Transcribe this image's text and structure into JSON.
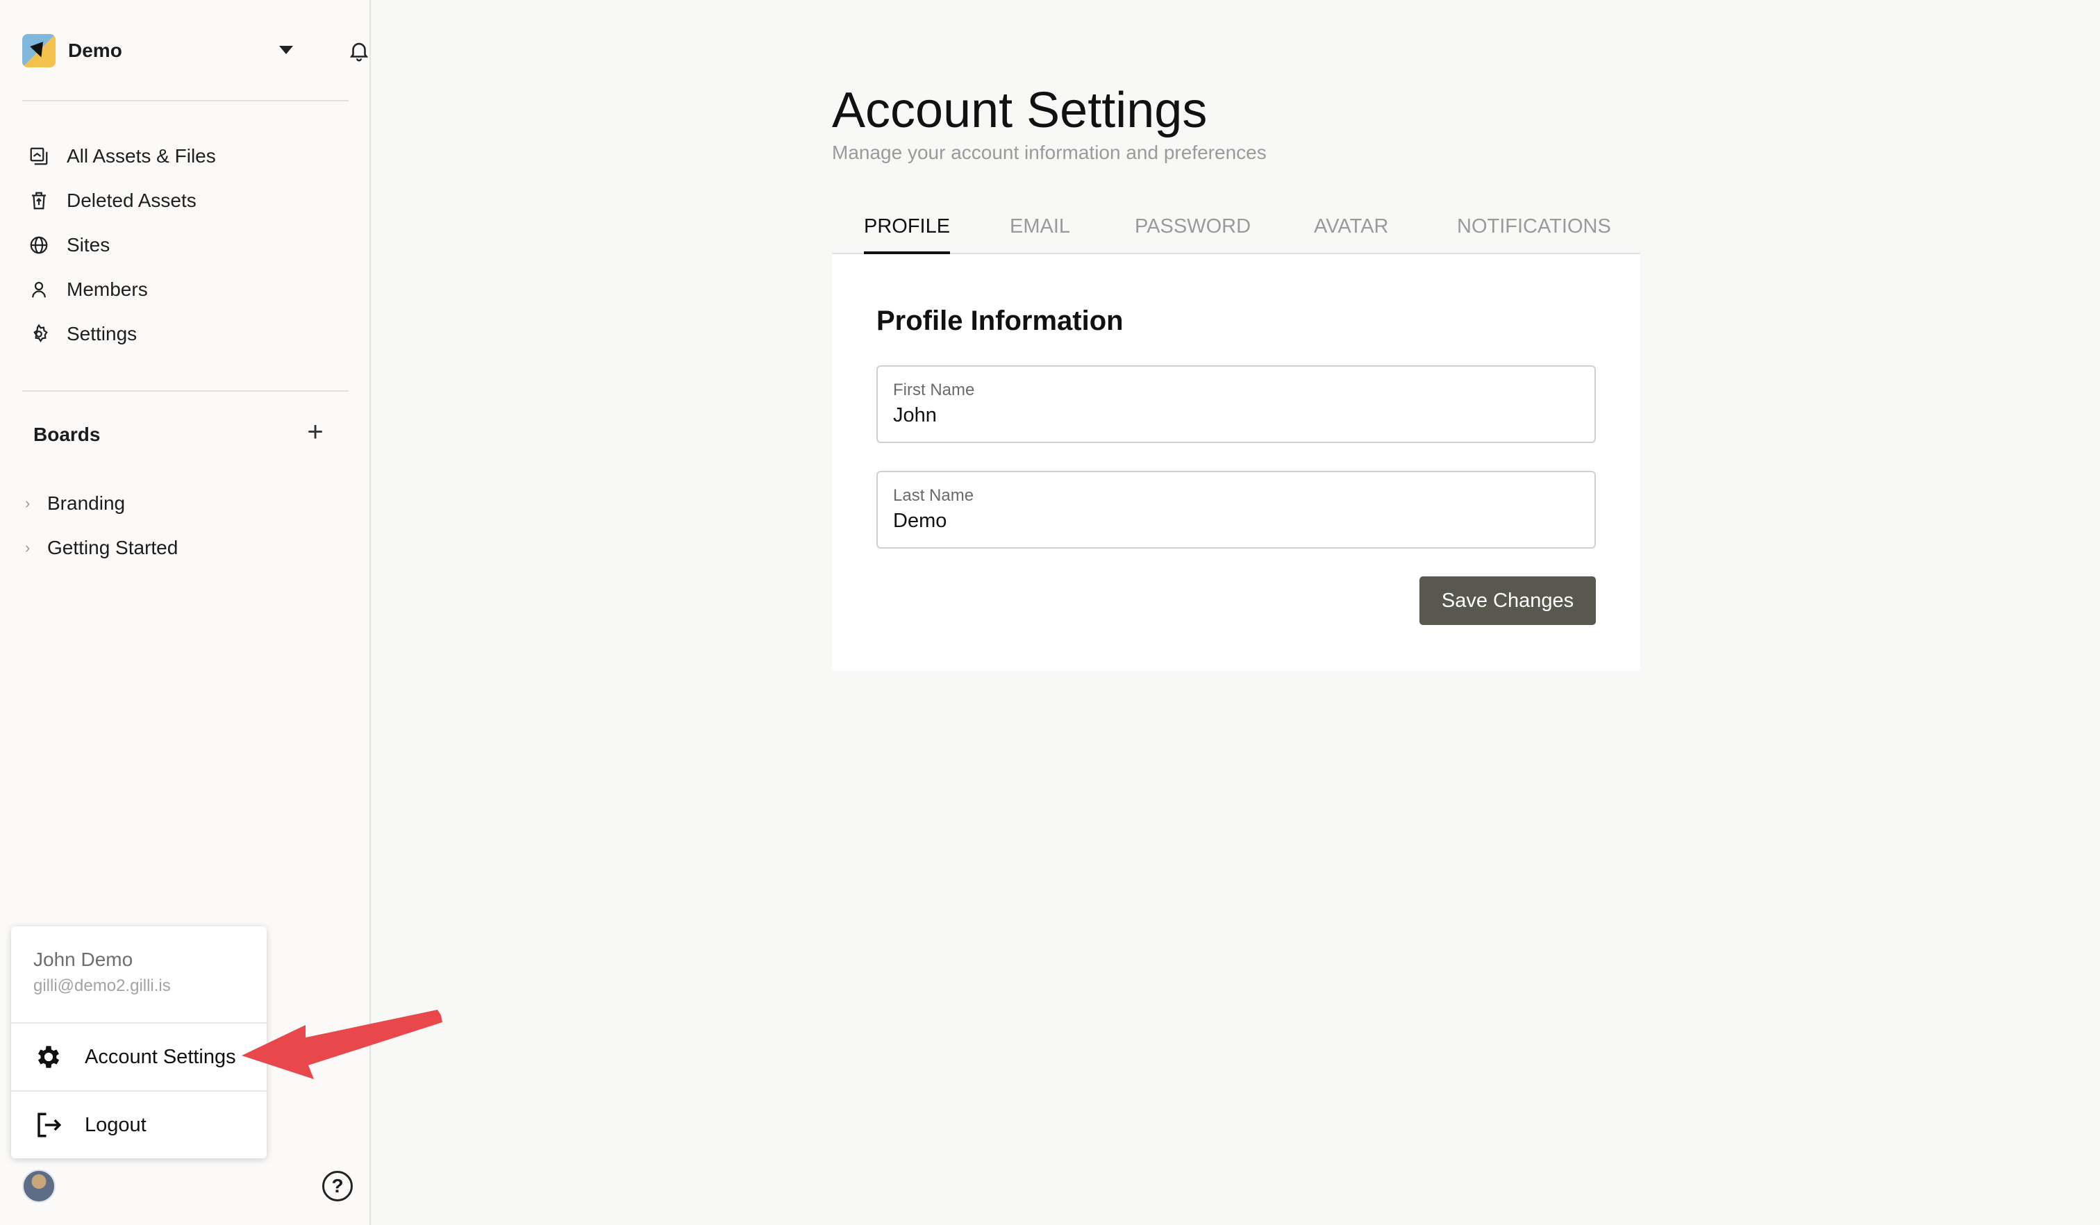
{
  "sidebar": {
    "workspace_name": "Demo",
    "nav": [
      {
        "label": "All Assets & Files",
        "icon": "files-icon"
      },
      {
        "label": "Deleted Assets",
        "icon": "trash-icon"
      },
      {
        "label": "Sites",
        "icon": "globe-icon"
      },
      {
        "label": "Members",
        "icon": "person-icon"
      },
      {
        "label": "Settings",
        "icon": "gear-icon"
      }
    ],
    "boards_title": "Boards",
    "boards": [
      {
        "label": "Branding"
      },
      {
        "label": "Getting Started"
      }
    ]
  },
  "user_menu": {
    "name": "John Demo",
    "email": "gilli@demo2.gilli.is",
    "items": [
      {
        "label": "Account Settings",
        "icon": "gear-icon"
      },
      {
        "label": "Logout",
        "icon": "logout-icon"
      }
    ]
  },
  "main": {
    "title": "Account Settings",
    "subtitle": "Manage your account information and preferences",
    "tabs": [
      {
        "label": "PROFILE",
        "active": true
      },
      {
        "label": "EMAIL",
        "active": false
      },
      {
        "label": "PASSWORD",
        "active": false
      },
      {
        "label": "AVATAR",
        "active": false
      },
      {
        "label": "NOTIFICATIONS",
        "active": false
      }
    ],
    "card_title": "Profile Information",
    "first_name": {
      "label": "First Name",
      "value": "John"
    },
    "last_name": {
      "label": "Last Name",
      "value": "Demo"
    },
    "save_label": "Save Changes"
  },
  "colors": {
    "accent_button": "#58584f",
    "annotation_arrow": "#e8474b"
  }
}
